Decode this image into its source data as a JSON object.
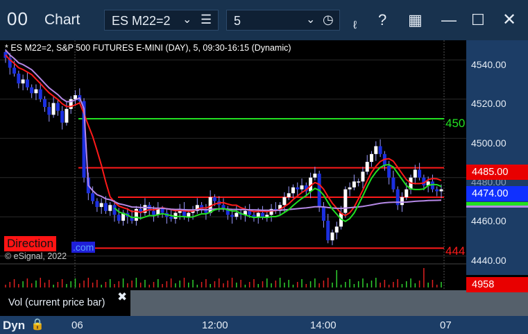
{
  "window": {
    "icon": "00",
    "title": "Chart",
    "symbol": "ES M22=2",
    "interval": "5",
    "icons": [
      "chevron-down-icon",
      "list-icon",
      "clock-icon",
      "draw-icon",
      "help-icon",
      "layout-icon",
      "minimize-icon",
      "maximize-icon",
      "close-icon"
    ]
  },
  "chart": {
    "header": "* ES M22=2, S&P 500 FUTURES E-MINI (DAY), 5, 09:30-16:15 (Dynamic)",
    "copyright": "© eSignal, 2022",
    "direction_label": "Direction",
    "direction_suffix": ".com",
    "green_line_label": "450",
    "red_line_label": "444",
    "colors": {
      "background": "#000000",
      "up_candle": "#ffffff",
      "down_candle": "#1b2fe0",
      "red_line": "#ff1a1a",
      "green_line": "#22e022",
      "vwap": "#b589e6",
      "axis_bg": "#1c3d66"
    }
  },
  "price_axis": {
    "ticks": [
      "4540.00",
      "4520.00",
      "4500.00",
      "4480.00",
      "4460.00",
      "4440.00"
    ],
    "last_red_label": "4485.00",
    "last_price_label": "4474.00"
  },
  "volume": {
    "label": "Vol (current price bar)",
    "value": "4958"
  },
  "time_axis": {
    "mode": "Dyn",
    "ticks": [
      "06",
      "12:00",
      "14:00",
      "07"
    ]
  },
  "chart_data": {
    "type": "candlestick",
    "ylim": [
      4436,
      4550
    ],
    "horizontal_levels": [
      4510,
      4485,
      4470,
      4444
    ],
    "series": [
      {
        "name": "Price",
        "values": [
          4541,
          4536,
          4533,
          4528,
          4530,
          4526,
          4523,
          4525,
          4520,
          4516,
          4512,
          4518,
          4514,
          4508,
          4515,
          4520,
          4522,
          4519,
          4480,
          4472,
          4468,
          4465,
          4467,
          4463,
          4466,
          4461,
          4458,
          4462,
          4460,
          4458,
          4464,
          4462,
          4466,
          4463,
          4461,
          4464,
          4462,
          4460,
          4459,
          4462,
          4464,
          4460,
          4462,
          4463,
          4466,
          4464,
          4462,
          4470,
          4468,
          4466,
          4464,
          4461,
          4460,
          4462,
          4461,
          4463,
          4461,
          4460,
          4462,
          4460,
          4461,
          4464,
          4463,
          4466,
          4470,
          4472,
          4475,
          4474,
          4476,
          4473,
          4480,
          4482,
          4465,
          4458,
          4448,
          4452,
          4455,
          4462,
          4474,
          4475,
          4478,
          4478,
          4483,
          4488,
          4492,
          4496,
          4492,
          4486,
          4480,
          4474,
          4466,
          4470,
          4474,
          4480,
          4484,
          4480,
          4476,
          4478,
          4474,
          4473,
          4474
        ]
      }
    ]
  }
}
